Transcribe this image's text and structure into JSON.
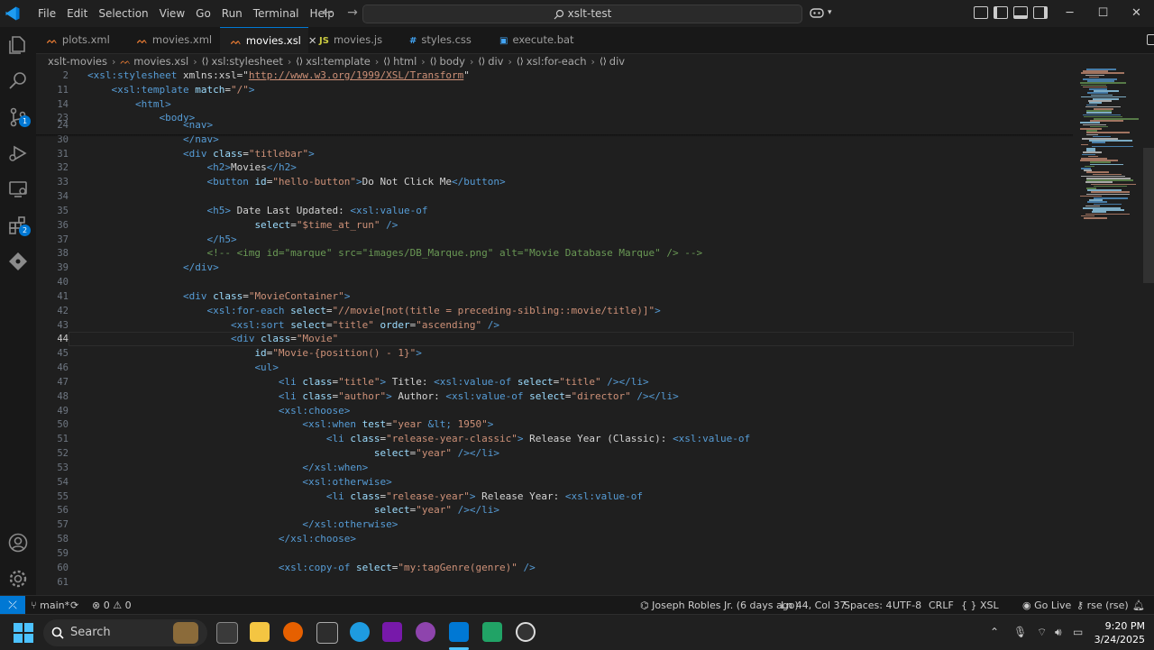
{
  "window": {
    "menu": [
      "File",
      "Edit",
      "Selection",
      "View",
      "Go",
      "Run",
      "Terminal",
      "Help"
    ],
    "search_text": "xslt-test",
    "controls": {
      "minimize": "─",
      "maximize": "☐",
      "close": "✕"
    }
  },
  "tabs": [
    {
      "icon": "rss",
      "label": "plots.xml",
      "active": false
    },
    {
      "icon": "rss",
      "label": "movies.xml",
      "active": false
    },
    {
      "icon": "rss",
      "label": "movies.xsl",
      "active": true
    },
    {
      "icon": "JS",
      "label": "movies.js",
      "active": false
    },
    {
      "icon": "#",
      "label": "styles.css",
      "active": false
    },
    {
      "icon": "bat",
      "label": "execute.bat",
      "active": false
    }
  ],
  "breadcrumb": [
    "xslt-movies",
    "movies.xsl",
    "xsl:stylesheet",
    "xsl:template",
    "html",
    "body",
    "div",
    "xsl:for-each",
    "div"
  ],
  "activity_badges": {
    "source_control": "1",
    "extensions": "2"
  },
  "editor": {
    "lines": [
      {
        "n": "2",
        "t": "<xsl:stylesheet xmlns:xsl=\"http://www.w3.org/1999/XSL/Transform\""
      },
      {
        "n": "11",
        "t": "    <xsl:template match=\"/\">"
      },
      {
        "n": "14",
        "t": "        <html>"
      },
      {
        "n": "23",
        "t": "            <body>"
      },
      {
        "n": "24",
        "t": "                <nav>"
      },
      {
        "n": "30",
        "t": "                </nav>"
      },
      {
        "n": "31",
        "t": "                <div class=\"titlebar\">"
      },
      {
        "n": "32",
        "t": "                    <h2>Movies</h2>"
      },
      {
        "n": "33",
        "t": "                    <button id=\"hello-button\">Do Not Click Me</button>"
      },
      {
        "n": "34",
        "t": ""
      },
      {
        "n": "35",
        "t": "                    <h5> Date Last Updated: <xsl:value-of"
      },
      {
        "n": "36",
        "t": "                            select=\"$time_at_run\" />"
      },
      {
        "n": "37",
        "t": "                    </h5>"
      },
      {
        "n": "38",
        "t": "                    <!-- <img id=\"marque\" src=\"images/DB_Marque.png\" alt=\"Movie Database Marque\" /> -->"
      },
      {
        "n": "39",
        "t": "                </div>"
      },
      {
        "n": "40",
        "t": ""
      },
      {
        "n": "41",
        "t": "                <div class=\"MovieContainer\">"
      },
      {
        "n": "42",
        "t": "                    <xsl:for-each select=\"//movie[not(title = preceding-sibling::movie/title)]\">"
      },
      {
        "n": "43",
        "t": "                        <xsl:sort select=\"title\" order=\"ascending\" />"
      },
      {
        "n": "44",
        "t": "                        <div class=\"Movie\""
      },
      {
        "n": "45",
        "t": "                            id=\"Movie-{position() - 1}\">"
      },
      {
        "n": "46",
        "t": "                            <ul>"
      },
      {
        "n": "47",
        "t": "                                <li class=\"title\"> Title: <xsl:value-of select=\"title\" /></li>"
      },
      {
        "n": "48",
        "t": "                                <li class=\"author\"> Author: <xsl:value-of select=\"director\" /></li>"
      },
      {
        "n": "49",
        "t": "                                <xsl:choose>"
      },
      {
        "n": "50",
        "t": "                                    <xsl:when test=\"year &lt; 1950\">"
      },
      {
        "n": "51",
        "t": "                                        <li class=\"release-year-classic\"> Release Year (Classic): <xsl:value-of"
      },
      {
        "n": "52",
        "t": "                                                select=\"year\" /></li>"
      },
      {
        "n": "53",
        "t": "                                    </xsl:when>"
      },
      {
        "n": "54",
        "t": "                                    <xsl:otherwise>"
      },
      {
        "n": "55",
        "t": "                                        <li class=\"release-year\"> Release Year: <xsl:value-of"
      },
      {
        "n": "56",
        "t": "                                                select=\"year\" /></li>"
      },
      {
        "n": "57",
        "t": "                                    </xsl:otherwise>"
      },
      {
        "n": "58",
        "t": "                                </xsl:choose>"
      },
      {
        "n": "59",
        "t": ""
      },
      {
        "n": "60",
        "t": "                                <xsl:copy-of select=\"my:tagGenre(genre)\" />"
      },
      {
        "n": "61",
        "t": ""
      }
    ],
    "current_line": "44"
  },
  "status": {
    "branch": "main*",
    "errors": "0",
    "warnings": "0",
    "blame": "Joseph Robles Jr. (6 days ago)",
    "position": "Ln 44, Col 37",
    "spaces": "Spaces: 4",
    "encoding": "UTF-8",
    "eol": "CRLF",
    "language": "XSL",
    "golive": "Go Live",
    "profile": "rse (rse)"
  },
  "taskbar": {
    "search_label": "Search",
    "time": "9:20 PM",
    "date": "3/24/2025"
  }
}
